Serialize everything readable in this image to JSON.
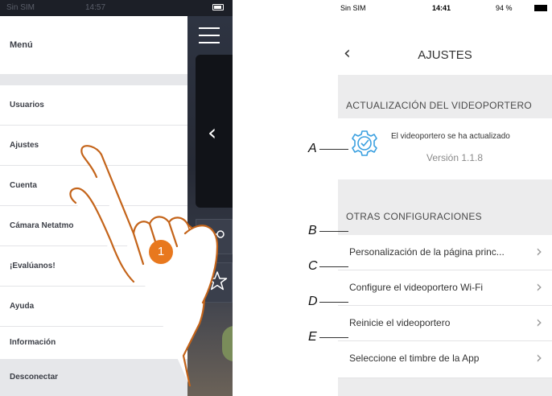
{
  "left_phone": {
    "status": {
      "carrier": "Sin SIM",
      "time": "14:57"
    },
    "menu": {
      "header": "Menú",
      "items": [
        "Usuarios",
        "Ajustes",
        "Cuenta",
        "Cámara Netatmo",
        "¡Evalúanos!",
        "Ayuda",
        "Información"
      ],
      "disconnect": "Desconectar"
    },
    "step_number": "1",
    "colors": {
      "badge": "#e8781e",
      "hand_outline": "#c4641a"
    }
  },
  "right_phone": {
    "status": {
      "carrier": "Sin SIM",
      "time": "14:41",
      "battery": "94 %"
    },
    "title": "AJUSTES",
    "update_section": {
      "heading": "ACTUALIZACIÓN DEL VIDEOPORTERO",
      "message": "El videoportero se ha actualizado",
      "version": "Versión 1.1.8",
      "icon": "settings-check-icon",
      "icon_color": "#3aa0e0"
    },
    "other_section": {
      "heading": "OTRAS CONFIGURACIONES",
      "rows": [
        {
          "label": "Personalización de la página princ..."
        },
        {
          "label": "Configure el videoportero Wi-Fi"
        },
        {
          "label": "Reinicie el videoportero"
        },
        {
          "label": "Seleccione el timbre de la App"
        }
      ]
    }
  },
  "callouts": [
    "A",
    "B",
    "C",
    "D",
    "E"
  ]
}
